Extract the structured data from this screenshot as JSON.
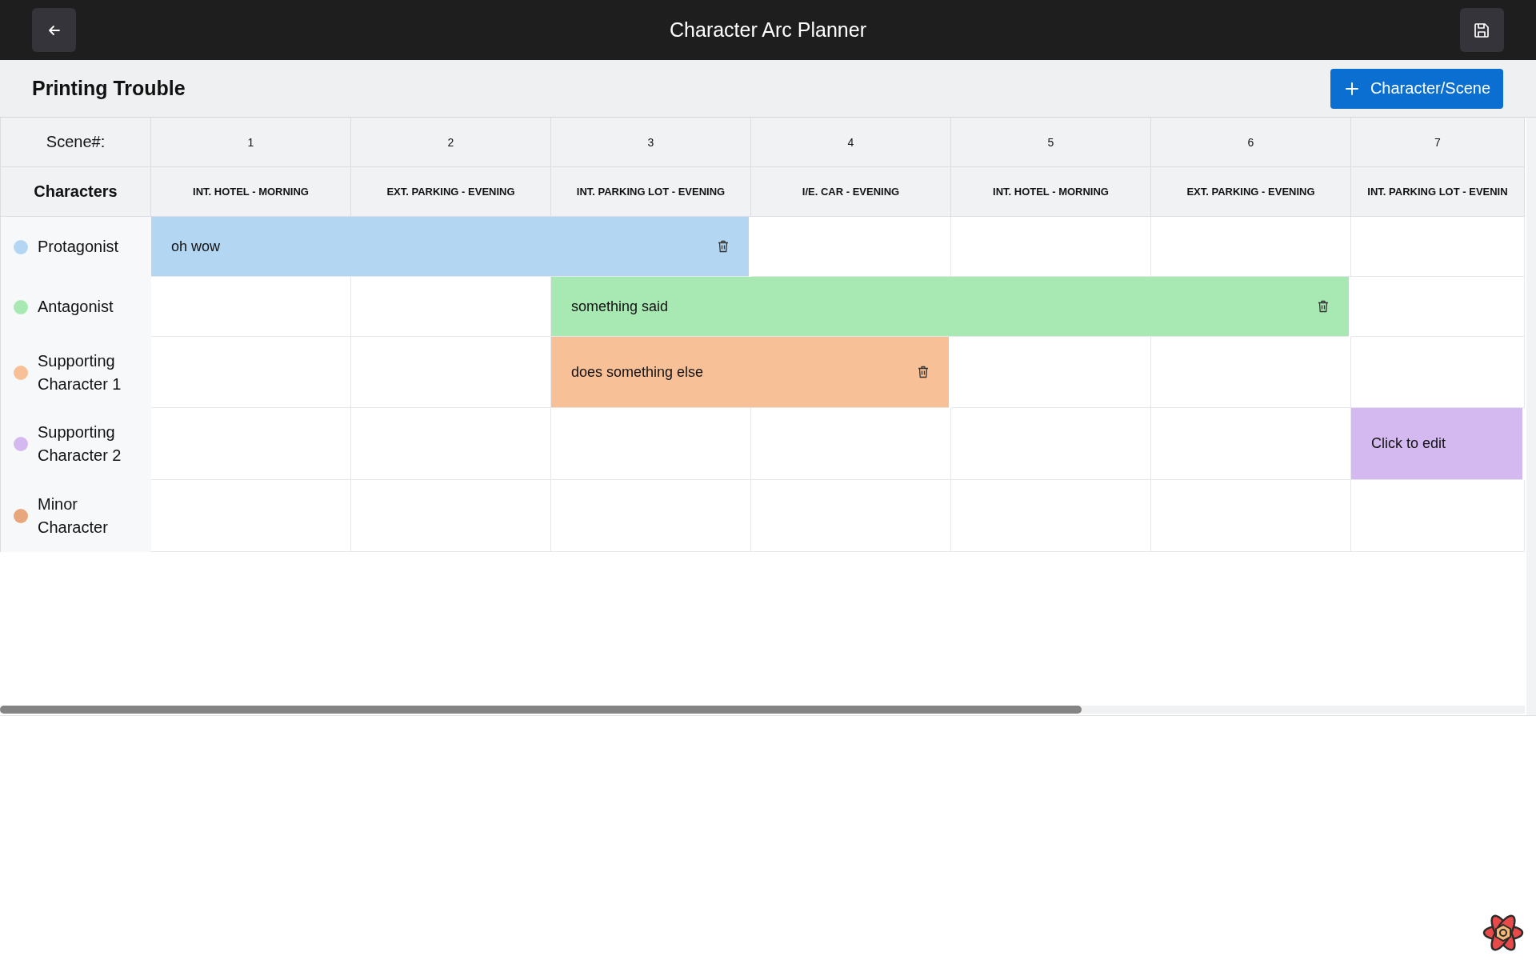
{
  "header": {
    "title": "Character Arc Planner"
  },
  "story": {
    "title": "Printing Trouble",
    "add_button": "Character/Scene"
  },
  "table": {
    "scene_label": "Scene#:",
    "characters_label": "Characters",
    "scenes": [
      {
        "number": "1",
        "heading": "INT. HOTEL - MORNING"
      },
      {
        "number": "2",
        "heading": "EXT. PARKING - EVENING"
      },
      {
        "number": "3",
        "heading": "INT. PARKING LOT - EVENING"
      },
      {
        "number": "4",
        "heading": "I/E. CAR - EVENING"
      },
      {
        "number": "5",
        "heading": "INT. HOTEL - MORNING"
      },
      {
        "number": "6",
        "heading": "EXT. PARKING - EVENING"
      },
      {
        "number": "7",
        "heading": "INT. PARKING LOT - EVENIN"
      }
    ],
    "rows": [
      {
        "name": "Protagonist",
        "color": "#b3d7f3",
        "cells": [
          {
            "kind": "arc",
            "text": "oh wow",
            "deletable": true
          },
          {
            "kind": "arc_continued"
          },
          {
            "kind": "arc_continued"
          },
          {
            "kind": "empty"
          },
          {
            "kind": "empty"
          },
          {
            "kind": "empty"
          },
          {
            "kind": "empty"
          }
        ]
      },
      {
        "name": "Antagonist",
        "color": "#a8e8b3",
        "cells": [
          {
            "kind": "empty"
          },
          {
            "kind": "empty"
          },
          {
            "kind": "arc",
            "text": "something said",
            "deletable": true
          },
          {
            "kind": "arc_continued"
          },
          {
            "kind": "arc_continued"
          },
          {
            "kind": "arc_continued"
          },
          {
            "kind": "empty"
          }
        ]
      },
      {
        "name": "Supporting Character 1",
        "color": "#f7c096",
        "cells": [
          {
            "kind": "empty"
          },
          {
            "kind": "empty"
          },
          {
            "kind": "arc",
            "text": "does something else",
            "deletable": true
          },
          {
            "kind": "arc_continued"
          },
          {
            "kind": "empty"
          },
          {
            "kind": "empty"
          },
          {
            "kind": "empty"
          }
        ]
      },
      {
        "name": "Supporting Character 2",
        "color": "#d4b8f0",
        "cells": [
          {
            "kind": "empty"
          },
          {
            "kind": "empty"
          },
          {
            "kind": "empty"
          },
          {
            "kind": "empty"
          },
          {
            "kind": "empty"
          },
          {
            "kind": "empty"
          },
          {
            "kind": "arc",
            "text": "Click to edit",
            "deletable": false
          }
        ]
      },
      {
        "name": "Minor Character",
        "color": "#e8a67c",
        "cells": [
          {
            "kind": "empty"
          },
          {
            "kind": "empty"
          },
          {
            "kind": "empty"
          },
          {
            "kind": "empty"
          },
          {
            "kind": "empty"
          },
          {
            "kind": "empty"
          },
          {
            "kind": "empty"
          }
        ]
      }
    ]
  }
}
